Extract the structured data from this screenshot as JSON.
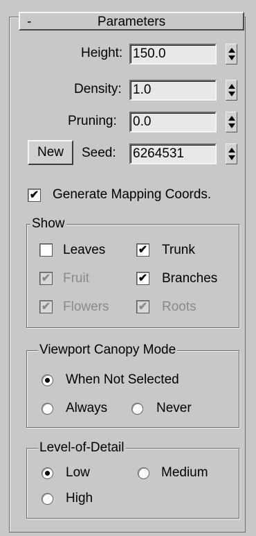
{
  "rollout": {
    "toggle": "-",
    "title": "Parameters"
  },
  "params": {
    "height_label": "Height:",
    "height_value": "150.0",
    "density_label": "Density:",
    "density_value": "1.0",
    "pruning_label": "Pruning:",
    "pruning_value": "0.0",
    "new_button": "New",
    "seed_label": "Seed:",
    "seed_value": "6264531"
  },
  "generate_mapping": {
    "label": "Generate Mapping Coords.",
    "checked": true
  },
  "show": {
    "title": "Show",
    "leaves": {
      "label": "Leaves",
      "checked": false,
      "enabled": true
    },
    "trunk": {
      "label": "Trunk",
      "checked": true,
      "enabled": true
    },
    "fruit": {
      "label": "Fruit",
      "checked": true,
      "enabled": false
    },
    "branches": {
      "label": "Branches",
      "checked": true,
      "enabled": true
    },
    "flowers": {
      "label": "Flowers",
      "checked": true,
      "enabled": false
    },
    "roots": {
      "label": "Roots",
      "checked": true,
      "enabled": false
    }
  },
  "canopy": {
    "title": "Viewport Canopy Mode",
    "when_not_selected": {
      "label": "When Not Selected",
      "selected": true
    },
    "always": {
      "label": "Always",
      "selected": false
    },
    "never": {
      "label": "Never",
      "selected": false
    }
  },
  "lod": {
    "title": "Level-of-Detail",
    "low": {
      "label": "Low",
      "selected": true
    },
    "medium": {
      "label": "Medium",
      "selected": false
    },
    "high": {
      "label": "High",
      "selected": false
    }
  },
  "glyphs": {
    "check": "✔"
  }
}
